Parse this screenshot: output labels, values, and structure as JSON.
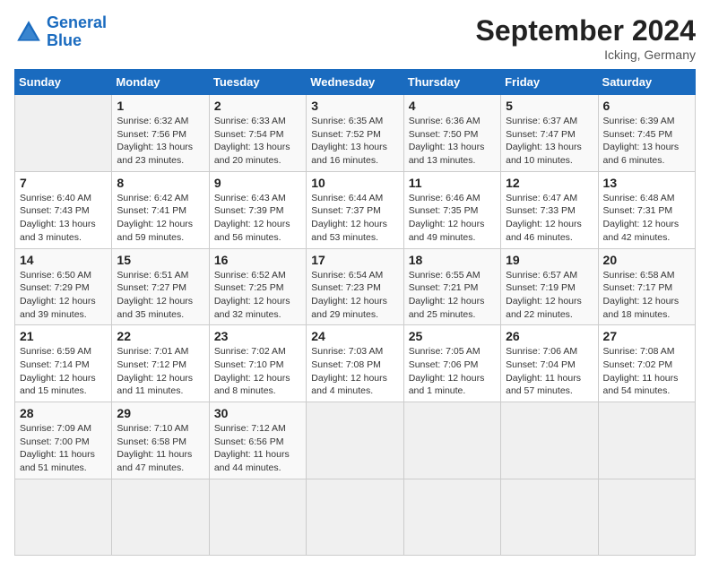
{
  "header": {
    "logo_line1": "General",
    "logo_line2": "Blue",
    "month": "September 2024",
    "location": "Icking, Germany"
  },
  "weekdays": [
    "Sunday",
    "Monday",
    "Tuesday",
    "Wednesday",
    "Thursday",
    "Friday",
    "Saturday"
  ],
  "days": [
    {
      "num": "",
      "sunrise": "",
      "sunset": "",
      "daylight": "",
      "empty": true
    },
    {
      "num": "1",
      "sunrise": "6:32 AM",
      "sunset": "7:56 PM",
      "daylight": "13 hours and 23 minutes."
    },
    {
      "num": "2",
      "sunrise": "6:33 AM",
      "sunset": "7:54 PM",
      "daylight": "13 hours and 20 minutes."
    },
    {
      "num": "3",
      "sunrise": "6:35 AM",
      "sunset": "7:52 PM",
      "daylight": "13 hours and 16 minutes."
    },
    {
      "num": "4",
      "sunrise": "6:36 AM",
      "sunset": "7:50 PM",
      "daylight": "13 hours and 13 minutes."
    },
    {
      "num": "5",
      "sunrise": "6:37 AM",
      "sunset": "7:47 PM",
      "daylight": "13 hours and 10 minutes."
    },
    {
      "num": "6",
      "sunrise": "6:39 AM",
      "sunset": "7:45 PM",
      "daylight": "13 hours and 6 minutes."
    },
    {
      "num": "7",
      "sunrise": "6:40 AM",
      "sunset": "7:43 PM",
      "daylight": "13 hours and 3 minutes."
    },
    {
      "num": "8",
      "sunrise": "6:42 AM",
      "sunset": "7:41 PM",
      "daylight": "12 hours and 59 minutes."
    },
    {
      "num": "9",
      "sunrise": "6:43 AM",
      "sunset": "7:39 PM",
      "daylight": "12 hours and 56 minutes."
    },
    {
      "num": "10",
      "sunrise": "6:44 AM",
      "sunset": "7:37 PM",
      "daylight": "12 hours and 53 minutes."
    },
    {
      "num": "11",
      "sunrise": "6:46 AM",
      "sunset": "7:35 PM",
      "daylight": "12 hours and 49 minutes."
    },
    {
      "num": "12",
      "sunrise": "6:47 AM",
      "sunset": "7:33 PM",
      "daylight": "12 hours and 46 minutes."
    },
    {
      "num": "13",
      "sunrise": "6:48 AM",
      "sunset": "7:31 PM",
      "daylight": "12 hours and 42 minutes."
    },
    {
      "num": "14",
      "sunrise": "6:50 AM",
      "sunset": "7:29 PM",
      "daylight": "12 hours and 39 minutes."
    },
    {
      "num": "15",
      "sunrise": "6:51 AM",
      "sunset": "7:27 PM",
      "daylight": "12 hours and 35 minutes."
    },
    {
      "num": "16",
      "sunrise": "6:52 AM",
      "sunset": "7:25 PM",
      "daylight": "12 hours and 32 minutes."
    },
    {
      "num": "17",
      "sunrise": "6:54 AM",
      "sunset": "7:23 PM",
      "daylight": "12 hours and 29 minutes."
    },
    {
      "num": "18",
      "sunrise": "6:55 AM",
      "sunset": "7:21 PM",
      "daylight": "12 hours and 25 minutes."
    },
    {
      "num": "19",
      "sunrise": "6:57 AM",
      "sunset": "7:19 PM",
      "daylight": "12 hours and 22 minutes."
    },
    {
      "num": "20",
      "sunrise": "6:58 AM",
      "sunset": "7:17 PM",
      "daylight": "12 hours and 18 minutes."
    },
    {
      "num": "21",
      "sunrise": "6:59 AM",
      "sunset": "7:14 PM",
      "daylight": "12 hours and 15 minutes."
    },
    {
      "num": "22",
      "sunrise": "7:01 AM",
      "sunset": "7:12 PM",
      "daylight": "12 hours and 11 minutes."
    },
    {
      "num": "23",
      "sunrise": "7:02 AM",
      "sunset": "7:10 PM",
      "daylight": "12 hours and 8 minutes."
    },
    {
      "num": "24",
      "sunrise": "7:03 AM",
      "sunset": "7:08 PM",
      "daylight": "12 hours and 4 minutes."
    },
    {
      "num": "25",
      "sunrise": "7:05 AM",
      "sunset": "7:06 PM",
      "daylight": "12 hours and 1 minute."
    },
    {
      "num": "26",
      "sunrise": "7:06 AM",
      "sunset": "7:04 PM",
      "daylight": "11 hours and 57 minutes."
    },
    {
      "num": "27",
      "sunrise": "7:08 AM",
      "sunset": "7:02 PM",
      "daylight": "11 hours and 54 minutes."
    },
    {
      "num": "28",
      "sunrise": "7:09 AM",
      "sunset": "7:00 PM",
      "daylight": "11 hours and 51 minutes."
    },
    {
      "num": "29",
      "sunrise": "7:10 AM",
      "sunset": "6:58 PM",
      "daylight": "11 hours and 47 minutes."
    },
    {
      "num": "30",
      "sunrise": "7:12 AM",
      "sunset": "6:56 PM",
      "daylight": "11 hours and 44 minutes."
    },
    {
      "num": "",
      "sunrise": "",
      "sunset": "",
      "daylight": "",
      "empty": true
    },
    {
      "num": "",
      "sunrise": "",
      "sunset": "",
      "daylight": "",
      "empty": true
    },
    {
      "num": "",
      "sunrise": "",
      "sunset": "",
      "daylight": "",
      "empty": true
    },
    {
      "num": "",
      "sunrise": "",
      "sunset": "",
      "daylight": "",
      "empty": true
    },
    {
      "num": "",
      "sunrise": "",
      "sunset": "",
      "daylight": "",
      "empty": true
    }
  ]
}
